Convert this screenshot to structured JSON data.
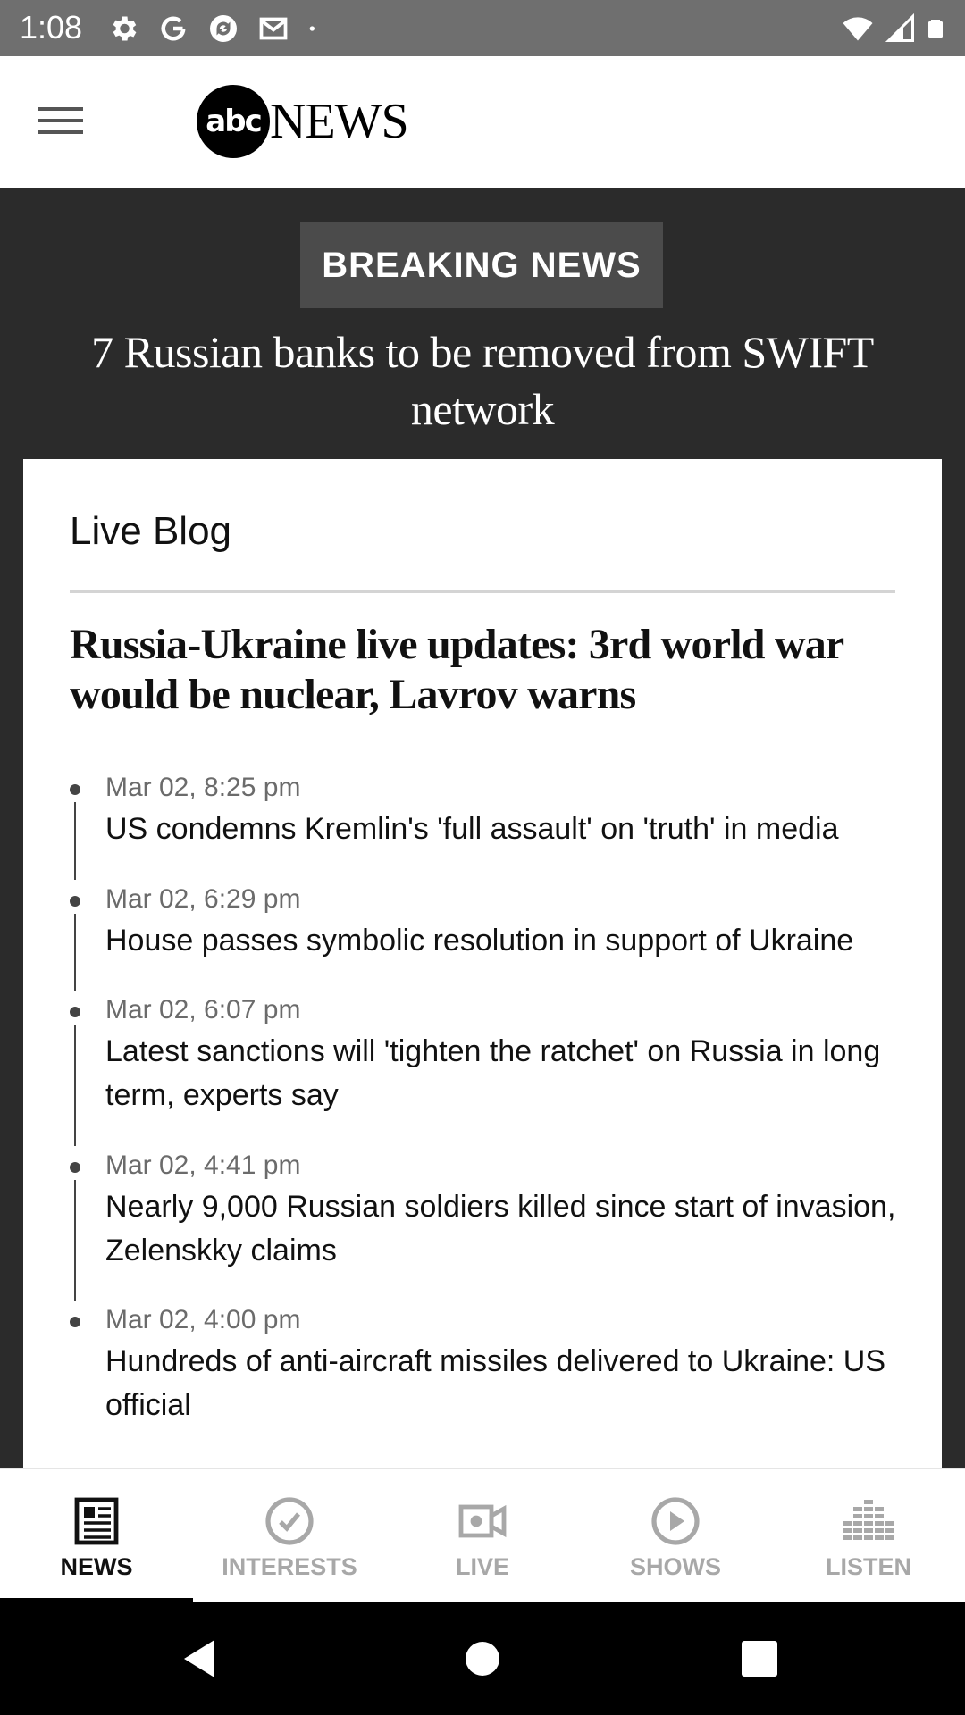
{
  "status_bar": {
    "time": "1:08",
    "left_icons": [
      "settings-icon",
      "google-icon",
      "sync-icon",
      "gmail-icon",
      "dot-icon"
    ],
    "right_icons": [
      "wifi-icon",
      "signal-icon",
      "battery-icon"
    ]
  },
  "app_bar": {
    "logo_abc": "abc",
    "logo_news": "NEWS"
  },
  "breaking": {
    "badge": "BREAKING NEWS",
    "headline": "7 Russian banks to be removed from SWIFT network"
  },
  "card": {
    "label": "Live Blog",
    "title": "Russia-Ukraine live updates: 3rd world war would be nuclear, Lavrov warns",
    "items": [
      {
        "time": "Mar 02, 8:25 pm",
        "text": "US condemns Kremlin's 'full assault' on 'truth' in media"
      },
      {
        "time": "Mar 02, 6:29 pm",
        "text": "House passes symbolic resolution in support of Ukraine"
      },
      {
        "time": "Mar 02, 6:07 pm",
        "text": "Latest sanctions will 'tighten the ratchet' on Russia in long term, experts say"
      },
      {
        "time": "Mar 02, 4:41 pm",
        "text": "Nearly 9,000 Russian soldiers killed since start of invasion, Zelenskky claims"
      },
      {
        "time": "Mar 02, 4:00 pm",
        "text": "Hundreds of anti-aircraft missiles delivered to Ukraine: US official"
      }
    ]
  },
  "bottom_nav": {
    "items": [
      {
        "label": "NEWS",
        "icon": "newspaper-icon",
        "active": true
      },
      {
        "label": "INTERESTS",
        "icon": "check-circle-icon",
        "active": false
      },
      {
        "label": "LIVE",
        "icon": "video-camera-icon",
        "active": false
      },
      {
        "label": "SHOWS",
        "icon": "play-circle-icon",
        "active": false
      },
      {
        "label": "LISTEN",
        "icon": "equalizer-icon",
        "active": false
      }
    ]
  },
  "colors": {
    "status_bar": "#6f6f6f",
    "dark_background": "#2b2b2b",
    "badge_background": "#4b4b4b",
    "inactive_nav": "#a8a8a8"
  }
}
